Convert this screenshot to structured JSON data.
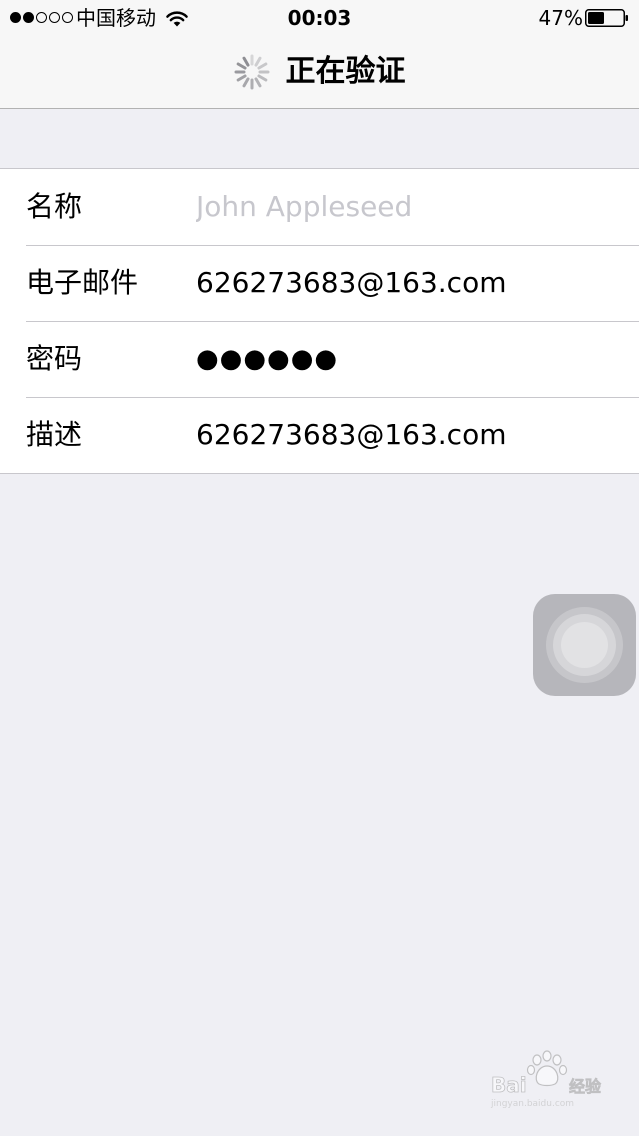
{
  "status_bar": {
    "carrier": "中国移动",
    "time": "00:03",
    "battery_percent": "47%",
    "battery_level": 0.47,
    "signal_bars": 2,
    "signal_total": 5,
    "icons": [
      "wifi-icon",
      "battery-icon"
    ]
  },
  "nav": {
    "title": "正在验证",
    "icons": [
      "activity-spinner-icon"
    ]
  },
  "form": {
    "rows": [
      {
        "label": "名称",
        "placeholder": "John Appleseed",
        "value": ""
      },
      {
        "label": "电子邮件",
        "value": "626273683@163.com"
      },
      {
        "label": "密码",
        "value": "●●●●●●"
      },
      {
        "label": "描述",
        "value": "626273683@163.com"
      }
    ]
  },
  "overlay": {
    "icons": [
      "assistive-touch-icon"
    ]
  },
  "watermark": {
    "icons": [
      "baidu-jingyan-logo"
    ],
    "logo_text": "Baidu 经验 jingyan.baidu.com"
  },
  "colors": {
    "background": "#efeff4",
    "bar": "#f7f7f7",
    "separator": "#c8c7cc",
    "placeholder": "#c7c7cd"
  }
}
